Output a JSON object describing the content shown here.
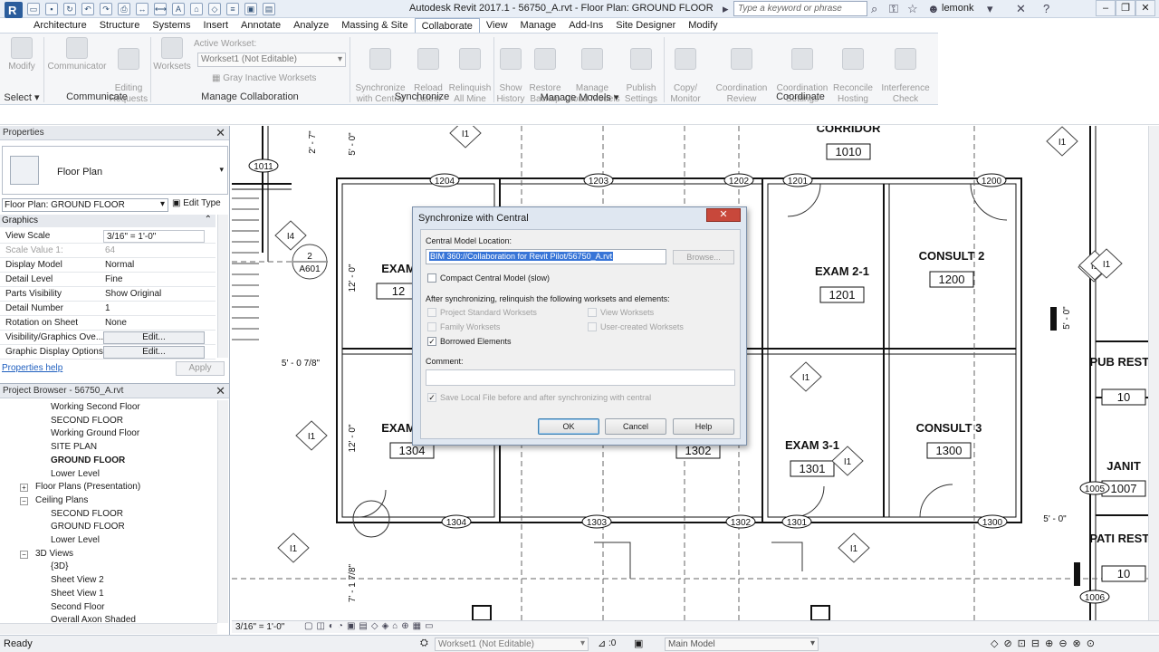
{
  "titlebar": {
    "title": "Autodesk Revit 2017.1 -     56750_A.rvt - Floor Plan: GROUND FLOOR",
    "search_placeholder": "Type a keyword or phrase",
    "user": "lemonk",
    "qat_icons": [
      "open-icon",
      "save-icon",
      "sync-icon",
      "undo-icon",
      "redo-icon",
      "print-icon",
      "measure-icon",
      "dimension-icon",
      "text-icon",
      "3d-view-icon",
      "section-icon",
      "thin-lines-icon",
      "close-hidden-icon",
      "switch-windows-icon"
    ]
  },
  "tabs": [
    "Architecture",
    "Structure",
    "Systems",
    "Insert",
    "Annotate",
    "Analyze",
    "Massing & Site",
    "Collaborate",
    "View",
    "Manage",
    "Add-Ins",
    "Site Designer",
    "Modify"
  ],
  "active_tab": "Collaborate",
  "ribbon": {
    "modify_label": "Modify",
    "communicator_label": "Communicator",
    "editing_requests_label": "Editing\nRequests",
    "worksets_label": "Worksets",
    "active_workset_label": "Active Workset:",
    "active_workset_value": "Workset1 (Not Editable)",
    "gray_inactive_label": "Gray Inactive Worksets",
    "sync_label": "Synchronize\nwith Central",
    "reload_label": "Reload\nLatest",
    "relinquish_label": "Relinquish\nAll Mine",
    "show_history_label": "Show\nHistory",
    "restore_backup_label": "Restore\nBackup",
    "manage_cloud_label": "Manage\nCloud Models",
    "publish_settings_label": "Publish\nSettings",
    "copy_monitor_label": "Copy/\nMonitor",
    "coord_review_label": "Coordination\nReview",
    "coord_settings_label": "Coordination\nSettings",
    "reconcile_label": "Reconcile\nHosting",
    "interference_label": "Interference\nCheck",
    "panels": {
      "select": "Select",
      "communicate": "Communicate",
      "manage_collab": "Manage Collaboration",
      "synchronize": "Synchronize",
      "manage_models": "Manage Models",
      "coordinate": "Coordinate"
    }
  },
  "properties": {
    "header": "Properties",
    "type_name": "Floor Plan",
    "instance_select": "Floor Plan: GROUND FLOOR",
    "edit_type": "Edit Type",
    "group": "Graphics",
    "rows": [
      {
        "key": "View Scale",
        "value": "3/16\" = 1'-0\"",
        "boxed": true,
        "muted": false
      },
      {
        "key": "Scale Value    1:",
        "value": "64",
        "boxed": false,
        "muted": true
      },
      {
        "key": "Display Model",
        "value": "Normal",
        "boxed": false,
        "muted": false
      },
      {
        "key": "Detail Level",
        "value": "Fine",
        "boxed": false,
        "muted": false
      },
      {
        "key": "Parts Visibility",
        "value": "Show Original",
        "boxed": false,
        "muted": false
      },
      {
        "key": "Detail Number",
        "value": "1",
        "boxed": false,
        "muted": false
      },
      {
        "key": "Rotation on Sheet",
        "value": "None",
        "boxed": false,
        "muted": false
      },
      {
        "key": "Visibility/Graphics Ove...",
        "value": "Edit...",
        "boxed": false,
        "button": true,
        "muted": false
      },
      {
        "key": "Graphic Display Options",
        "value": "Edit...",
        "boxed": false,
        "button": true,
        "muted": false
      }
    ],
    "help_link": "Properties help",
    "apply": "Apply"
  },
  "browser": {
    "header": "Project Browser - 56750_A.rvt",
    "items": [
      {
        "label": "Working Second Floor",
        "indent": 3,
        "toggle": ""
      },
      {
        "label": "SECOND FLOOR",
        "indent": 3,
        "toggle": ""
      },
      {
        "label": "Working Ground Floor",
        "indent": 3,
        "toggle": ""
      },
      {
        "label": "SITE PLAN",
        "indent": 3,
        "toggle": ""
      },
      {
        "label": "GROUND FLOOR",
        "indent": 3,
        "toggle": "",
        "bold": true
      },
      {
        "label": "Lower Level",
        "indent": 3,
        "toggle": ""
      },
      {
        "label": "Floor Plans (Presentation)",
        "indent": 2,
        "toggle": "+"
      },
      {
        "label": "Ceiling Plans",
        "indent": 2,
        "toggle": "−"
      },
      {
        "label": "SECOND FLOOR",
        "indent": 3,
        "toggle": ""
      },
      {
        "label": "GROUND FLOOR",
        "indent": 3,
        "toggle": ""
      },
      {
        "label": "Lower Level",
        "indent": 3,
        "toggle": ""
      },
      {
        "label": "3D Views",
        "indent": 2,
        "toggle": "−"
      },
      {
        "label": "{3D}",
        "indent": 3,
        "toggle": ""
      },
      {
        "label": "Sheet View 2",
        "indent": 3,
        "toggle": ""
      },
      {
        "label": "Sheet View 1",
        "indent": 3,
        "toggle": ""
      },
      {
        "label": "Second Floor",
        "indent": 3,
        "toggle": ""
      },
      {
        "label": "Overall Axon Shaded",
        "indent": 3,
        "toggle": ""
      }
    ]
  },
  "plan": {
    "rooms": [
      {
        "name": "CORRIDOR",
        "number": "1010"
      },
      {
        "name": "CONSULT 2",
        "number": "1200"
      },
      {
        "name": "EXAM 2-1",
        "number": "1201"
      },
      {
        "name": "CONSULT 3",
        "number": "1300"
      },
      {
        "name": "EXAM 3-1",
        "number": "1301"
      },
      {
        "name": "EXAM",
        "number": "12"
      },
      {
        "name": "EXAM",
        "number": "1304"
      },
      {
        "name": "",
        "number": "1302"
      },
      {
        "name": "PUB\nRESTR",
        "number": "10"
      },
      {
        "name": "JANIT",
        "number": "1007"
      },
      {
        "name": "PATI\nRESTR",
        "number": "10"
      }
    ],
    "door_tags": [
      "1011",
      "1204",
      "1203",
      "1202",
      "1201",
      "1200",
      "1304",
      "1303",
      "1302",
      "1301",
      "1300",
      "1005",
      "1006"
    ],
    "type_tags": [
      "I1",
      "I4",
      "I1",
      "I1",
      "I1",
      "I1",
      "I1",
      "I1",
      "I1",
      "I1",
      "I1"
    ],
    "dims": [
      "5' - 0\"",
      "12' - 0\"",
      "12' - 0\"",
      "5' - 0 7/8\"",
      "7' - 1 7/8\"",
      "2' - 7\"",
      "5' - 0\"",
      "5' - 0\""
    ],
    "section_tag": {
      "num": "2",
      "sheet": "A601"
    }
  },
  "view_bar": {
    "scale": "3/16\" = 1'-0\""
  },
  "status": {
    "text": "Ready",
    "workset": "Workset1 (Not Editable)",
    "selection_count": ":0",
    "model": "Main Model"
  },
  "dialog": {
    "title": "Synchronize with Central",
    "location_label": "Central Model Location:",
    "location_value": "BIM 360://Collaboration for Revit Pilot/56750_A.rvt",
    "browse": "Browse...",
    "compact": "Compact Central Model (slow)",
    "relinquish_label": "After synchronizing, relinquish the following worksets and elements:",
    "options": [
      {
        "label": "Project Standard Worksets",
        "checked": false,
        "disabled": true
      },
      {
        "label": "View Worksets",
        "checked": false,
        "disabled": true
      },
      {
        "label": "Family Worksets",
        "checked": false,
        "disabled": true
      },
      {
        "label": "User-created Worksets",
        "checked": false,
        "disabled": true
      },
      {
        "label": "Borrowed Elements",
        "checked": true,
        "disabled": false
      }
    ],
    "comment_label": "Comment:",
    "save_local": "Save Local File before and after synchronizing with central",
    "ok": "OK",
    "cancel": "Cancel",
    "help": "Help"
  }
}
